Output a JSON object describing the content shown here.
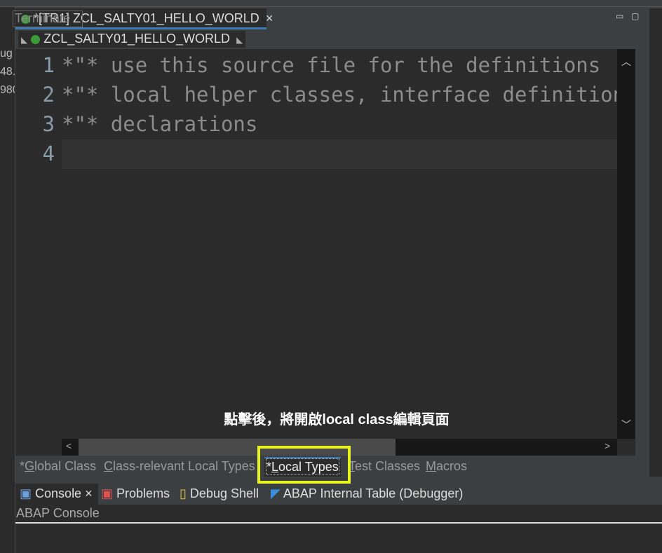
{
  "left_fragments": [
    "ug",
    "48.",
    "980"
  ],
  "editor_tab": {
    "title": "*[TR1] ZCL_SALTY01_HELLO_WORLD",
    "ghost": "Terminate",
    "close": "×"
  },
  "breadcrumb": {
    "item": "ZCL_SALTY01_HELLO_WORLD"
  },
  "code_lines": [
    {
      "n": "1",
      "text": "*\"* use this source file for the definitions"
    },
    {
      "n": "2",
      "text": "*\"* local helper classes, interface definitions"
    },
    {
      "n": "3",
      "text": "*\"* declarations"
    },
    {
      "n": "4",
      "text": ""
    }
  ],
  "overlay_caption": "點擊後，將開啟local class編輯頁面",
  "page_tabs": [
    {
      "prefix": "*",
      "mn": "G",
      "rest": "lobal Class"
    },
    {
      "prefix": "",
      "mn": "C",
      "rest": "lass-relevant Local Types"
    },
    {
      "prefix": "*",
      "mn": "L",
      "rest": "ocal Types"
    },
    {
      "prefix": "",
      "mn": "T",
      "rest": "est Classes"
    },
    {
      "prefix": "",
      "mn": "M",
      "rest": "acros"
    }
  ],
  "console_tabs": [
    "Console",
    "Problems",
    "Debug Shell",
    "ABAP Internal Table (Debugger)"
  ],
  "console_title": "ABAP Console",
  "colors": {
    "highlight": "#e6f31e",
    "accent": "#3d7ab4"
  }
}
